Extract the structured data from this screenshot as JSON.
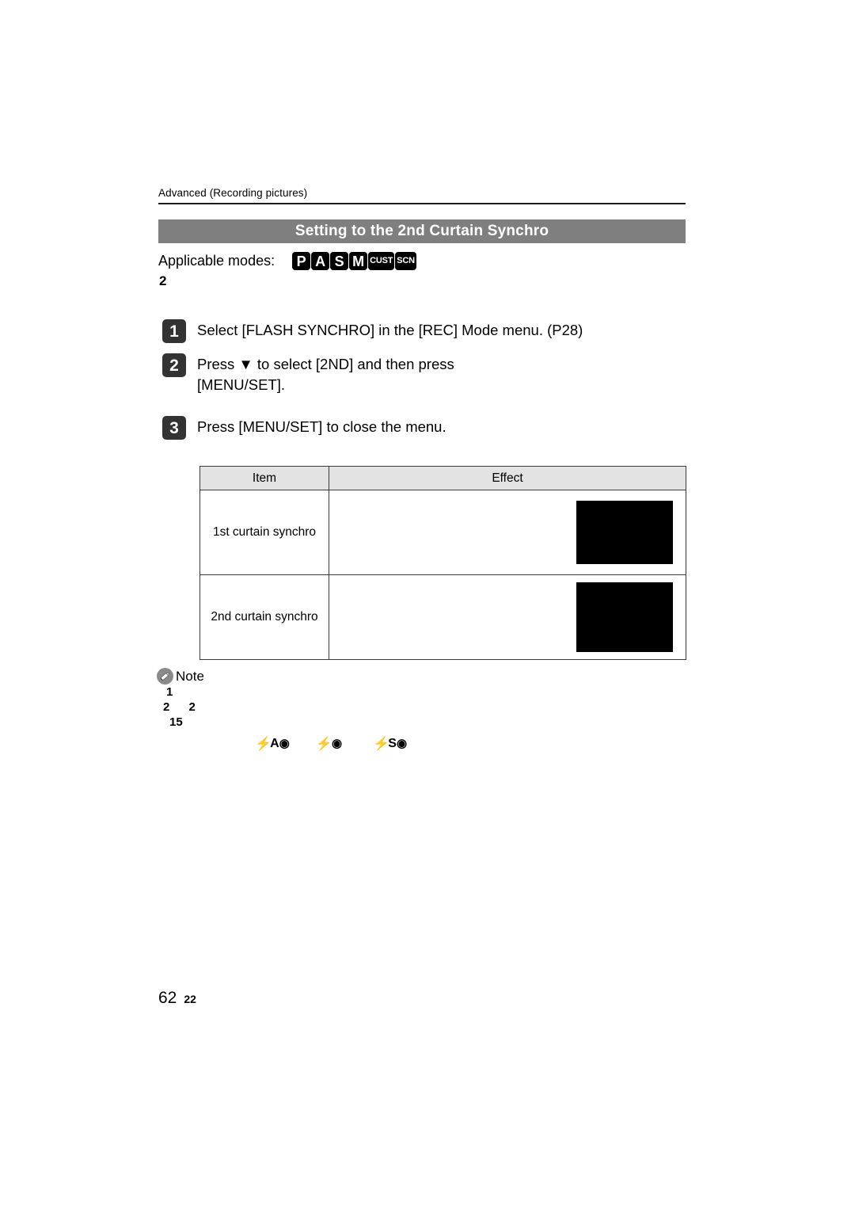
{
  "document": {
    "running_head": "Advanced (Recording pictures)",
    "section_title": "Setting to the 2nd Curtain Synchro",
    "chapter_marker": "2",
    "page_number": "62",
    "page_number_sub": "22",
    "banner_color": "#7f7f7f",
    "header_rule_color": "#1a1a1a"
  },
  "applicable_modes": {
    "label": "Applicable modes:",
    "badges": [
      {
        "name": "mode-badge-p",
        "text": "P",
        "style": "large"
      },
      {
        "name": "mode-badge-a",
        "text": "A",
        "style": "large"
      },
      {
        "name": "mode-badge-s",
        "text": "S",
        "style": "large"
      },
      {
        "name": "mode-badge-m",
        "text": "M",
        "style": "large"
      },
      {
        "name": "mode-badge-cust",
        "text": "CUST",
        "style": "small"
      },
      {
        "name": "mode-badge-scn",
        "text": "SCN",
        "style": "small"
      }
    ]
  },
  "steps": [
    {
      "number": "1",
      "text": "Select [FLASH SYNCHRO] in the [REC] Mode menu. (P28)"
    },
    {
      "number": "2",
      "text": "Press ▼ to select [2ND] and then press\n[MENU/SET]."
    },
    {
      "number": "3",
      "text": "Press [MENU/SET] to close the menu."
    }
  ],
  "table": {
    "headers": [
      "Item",
      "Effect"
    ],
    "rows": [
      {
        "item": "1st curtain synchro",
        "effect_image": "photo-placeholder-1st-curtain"
      },
      {
        "item": "2nd curtain synchro",
        "effect_image": "photo-placeholder-2nd-curtain"
      }
    ],
    "header_bg": "#e3e3e3",
    "border_color": "#3a3a3a",
    "image_fill": "#000000"
  },
  "note": {
    "icon": "pencil-icon",
    "label": "Note",
    "lines": [
      "1",
      "2  2",
      "15"
    ]
  },
  "flash_icons": [
    {
      "name": "flash-auto-redeye-icon",
      "bolt": "⚡",
      "letter": "A",
      "eye": "◉"
    },
    {
      "name": "flash-on-redeye-icon",
      "bolt": "⚡",
      "letter": "",
      "eye": "◉"
    },
    {
      "name": "flash-slow-sync-redeye-icon",
      "bolt": "⚡",
      "letter": "S",
      "eye": "◉"
    }
  ]
}
